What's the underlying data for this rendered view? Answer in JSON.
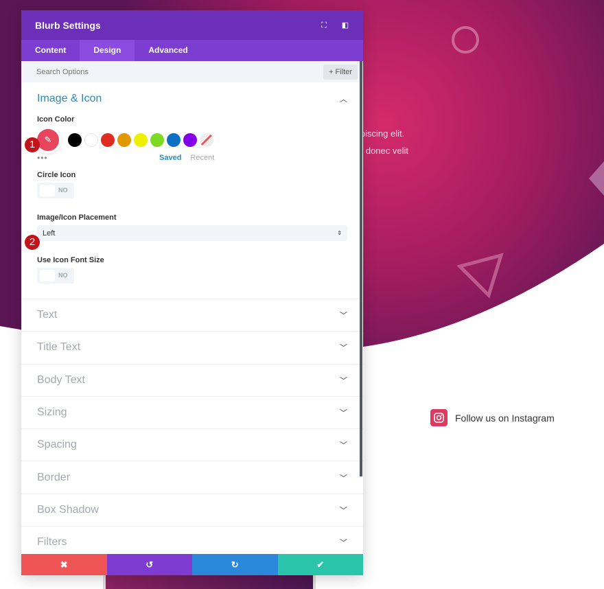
{
  "colors": {
    "header": "#6b2fb8",
    "tabs": "#7b3ed0",
    "accent": "#2e8ab8",
    "cancel": "#ef5555",
    "undo": "#7d3bcf",
    "redo": "#2b87da",
    "save": "#29c4a9"
  },
  "background": {
    "text_line1": "ipiscing elit.",
    "text_line2": "e donec velit",
    "instagram_label": "Follow us on Instagram"
  },
  "panel": {
    "title": "Blurb Settings",
    "tabs": [
      {
        "label": "Content"
      },
      {
        "label": "Design",
        "active": true
      },
      {
        "label": "Advanced"
      }
    ],
    "search_placeholder": "Search Options",
    "filter_label": "+ Filter",
    "section_title": "Image & Icon",
    "icon_color_label": "Icon Color",
    "swatches": [
      "#000000",
      "#ffffff",
      "#e02b20",
      "#e09900",
      "#edf000",
      "#7cda24",
      "#0c71c3",
      "#8300e9"
    ],
    "selected_color": "#e8445e",
    "saved_label": "Saved",
    "recent_label": "Recent",
    "circle_icon_label": "Circle Icon",
    "circle_icon_value": "NO",
    "placement_label": "Image/Icon Placement",
    "placement_value": "Left",
    "font_size_label": "Use Icon Font Size",
    "font_size_value": "NO",
    "badges": [
      "1",
      "2"
    ],
    "sections": [
      "Text",
      "Title Text",
      "Body Text",
      "Sizing",
      "Spacing",
      "Border",
      "Box Shadow",
      "Filters"
    ]
  }
}
